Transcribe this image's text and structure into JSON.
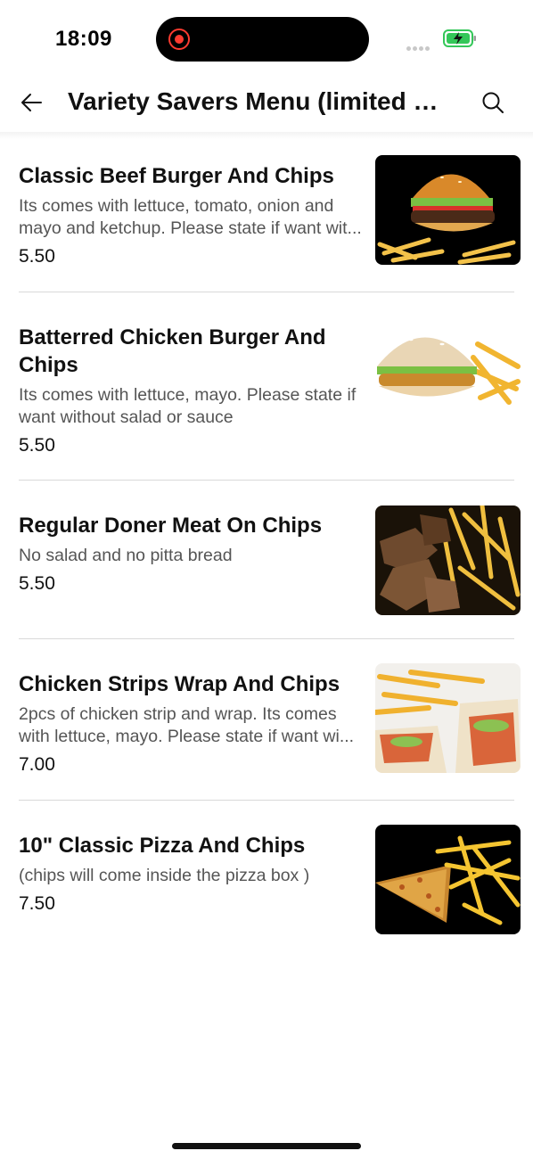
{
  "status": {
    "time": "18:09"
  },
  "header": {
    "title": "Variety Savers Menu (limited T..."
  },
  "items": [
    {
      "name": "Classic Beef Burger And Chips",
      "description": "Its comes with lettuce, tomato, onion and mayo and ketchup. Please state if want wit...",
      "price": "5.50",
      "image_icon": "burger-fries-image"
    },
    {
      "name": "Batterred Chicken Burger And Chips",
      "description": "Its comes with lettuce, mayo. Please state if want without salad or sauce",
      "price": "5.50",
      "image_icon": "chicken-burger-image"
    },
    {
      "name": "Regular Doner Meat On Chips",
      "description": "No salad and no pitta bread",
      "price": "5.50",
      "image_icon": "doner-chips-image"
    },
    {
      "name": "Chicken Strips Wrap And Chips",
      "description": "2pcs of chicken strip and wrap. Its comes with lettuce, mayo. Please state if  want wi...",
      "price": "7.00",
      "image_icon": "wrap-chips-image"
    },
    {
      "name": "10\" Classic Pizza And Chips",
      "description": "(chips will come inside the pizza box )",
      "price": "7.50",
      "image_icon": "pizza-chips-image"
    }
  ],
  "colors": {
    "record": "#ff3b30",
    "battery": "#34c759",
    "divider": "#d9d9d9",
    "text_secondary": "#555555"
  }
}
